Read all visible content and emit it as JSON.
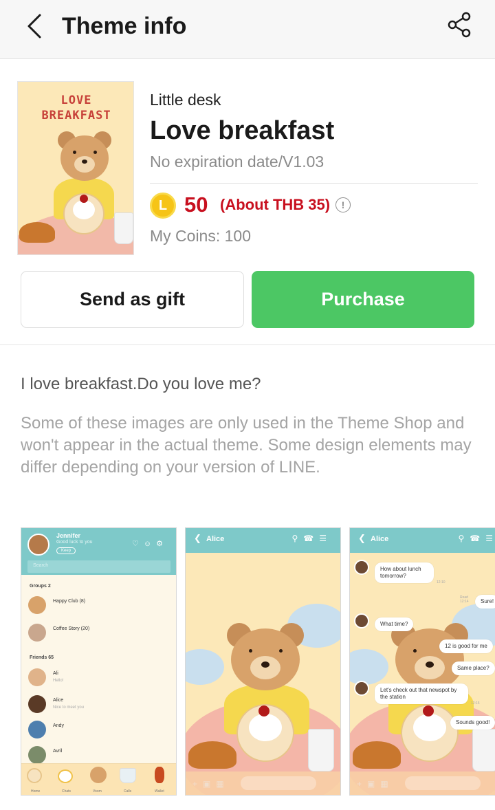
{
  "header": {
    "title": "Theme info",
    "back_icon": "chevron-left-icon",
    "share_icon": "share-icon"
  },
  "theme": {
    "thumbnail_title": "LOVE BREAKFAST",
    "author": "Little desk",
    "name": "Love breakfast",
    "expiry": "No expiration date/V1.03",
    "coin_icon_letter": "L",
    "price": "50",
    "price_local": "(About THB 35)",
    "info_icon": "!",
    "my_coins": "My Coins: 100"
  },
  "actions": {
    "gift_label": "Send as gift",
    "purchase_label": "Purchase"
  },
  "description": "I love breakfast.Do you love me?",
  "note": "Some of these images are only used in the Theme Shop and won't appear in the actual theme. Some design elements may differ depending on your version of LINE.",
  "colors": {
    "accent_green": "#4cc764",
    "price_red": "#c8101f",
    "preview_teal": "#7ec9c9"
  },
  "preview1": {
    "user": "Jennifer",
    "status": "Good luck to you",
    "keep": "Keep",
    "search": "Search",
    "groups": "Groups 2",
    "group_items": [
      {
        "name": "Happy Club (8)"
      },
      {
        "name": "Coffee Story (20)"
      }
    ],
    "friends": "Friends 65",
    "friend_items": [
      {
        "name": "Ali",
        "sub": "Hello!"
      },
      {
        "name": "Alice",
        "sub": "Nice to meet you"
      },
      {
        "name": "Andy",
        "sub": ""
      },
      {
        "name": "Avril",
        "sub": ""
      }
    ],
    "tabs": [
      "Home",
      "Chats",
      "Voom",
      "Calls",
      "Wallet"
    ]
  },
  "preview2": {
    "chat_title": "Alice"
  },
  "preview3": {
    "chat_title": "Alice",
    "messages": [
      {
        "text": "How about lunch tomorrow?",
        "side": "left"
      },
      {
        "text": "Sure!",
        "side": "right"
      },
      {
        "text": "What time?",
        "side": "left"
      },
      {
        "text": "12 is good for me",
        "side": "right"
      },
      {
        "text": "Same place?",
        "side": "right"
      },
      {
        "text": "Let's check out that newspot by the station",
        "side": "left"
      },
      {
        "text": "Sounds good!",
        "side": "right"
      }
    ],
    "timestamps": [
      "12:10",
      "Read 12:14",
      "12:15"
    ]
  }
}
